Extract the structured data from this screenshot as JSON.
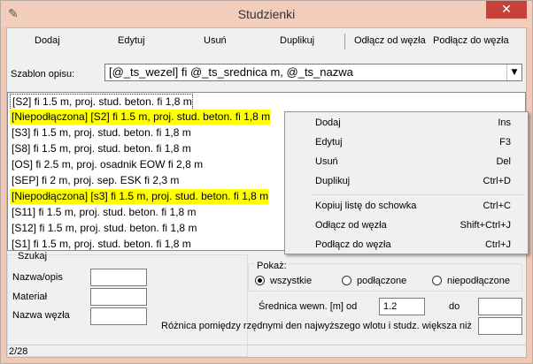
{
  "window": {
    "title": "Studzienki",
    "close_glyph": "✕",
    "app_icon": "✎"
  },
  "toolbar": {
    "dodaj": "Dodaj",
    "edytuj": "Edytuj",
    "usun": "Usuń",
    "duplikuj": "Duplikuj",
    "odlacz": "Odłącz od węzła",
    "podlacz": "Podłącz do węzła"
  },
  "template": {
    "label": "Szablon opisu:",
    "value": "[@_ts_wezel] fi @_ts_srednica m, @_ts_nazwa",
    "arrow": "▼"
  },
  "list": {
    "items": [
      "[S2] fi 1.5 m, proj. stud. beton. fi 1,8 m",
      "[Niepodłączona] [S2] fi 1.5 m, proj. stud. beton. fi 1,8 m",
      "[S3] fi 1.5 m, proj. stud. beton. fi 1,8 m",
      "[S8] fi 1.5 m, proj. stud. beton. fi 1,8 m",
      "[OS] fi 2.5 m, proj. osadnik EOW fi 2,8 m",
      "[SEP] fi 2 m, proj. sep. ESK fi 2,3 m",
      "[Niepodłączona] [s3] fi 1.5 m, proj. stud. beton. fi 1,8 m",
      "[S11] fi 1.5 m, proj. stud. beton. fi 1,8 m",
      "[S12] fi 1.5 m, proj. stud. beton. fi 1,8 m",
      "[S1] fi 1.5 m, proj. stud. beton. fi 1,8 m"
    ]
  },
  "context_menu": {
    "items": [
      {
        "label": "Dodaj",
        "shortcut": "Ins"
      },
      {
        "label": "Edytuj",
        "shortcut": "F3"
      },
      {
        "label": "Usuń",
        "shortcut": "Del"
      },
      {
        "label": "Duplikuj",
        "shortcut": "Ctrl+D"
      },
      {
        "label": "Kopiuj listę do schowka",
        "shortcut": "Ctrl+C"
      },
      {
        "label": "Odłącz od węzła",
        "shortcut": "Shift+Ctrl+J"
      },
      {
        "label": "Podłącz do węzła",
        "shortcut": "Ctrl+J"
      }
    ]
  },
  "search": {
    "legend": "Szukaj",
    "name_label": "Nazwa/opis",
    "name_value": "",
    "material_label": "Materiał",
    "material_value": "",
    "node_label": "Nazwa węzła",
    "node_value": ""
  },
  "show": {
    "legend": "Pokaż:",
    "options": [
      {
        "label": "wszystkie",
        "checked": true
      },
      {
        "label": "podłączone",
        "checked": false
      },
      {
        "label": "niepodłączone",
        "checked": false
      }
    ]
  },
  "diameter": {
    "label": "Średnica wewn. [m] od",
    "from_value": "1.2",
    "to_label": "do",
    "to_value": ""
  },
  "difference": {
    "label": "Różnica pomiędzy rzędnymi den najwyższego wlotu i studz. większa niż",
    "value": ""
  },
  "status": {
    "text": "2/28"
  },
  "colors": {
    "highlight": "#ffff00",
    "close_button": "#c7413a",
    "titlebar": "#f3cdbb"
  }
}
